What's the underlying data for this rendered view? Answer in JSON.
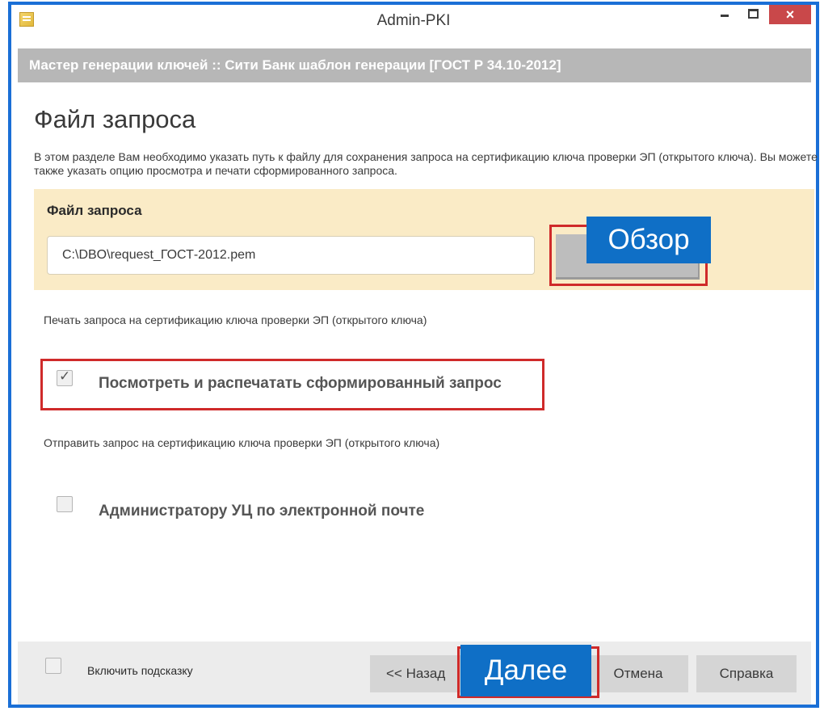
{
  "window": {
    "title": "Admin-PKI",
    "close_glyph": "×"
  },
  "wizard": {
    "header": "Мастер генерации ключей :: Сити Банк шаблон генерации [ГОСТ Р 34.10-2012]",
    "page_title": "Файл запроса",
    "description": "В этом разделе Вам необходимо указать путь к файлу для сохранения запроса на сертификацию ключа проверки ЭП (открытого ключа). Вы можете также указать опцию просмотра и печати сформированного запроса."
  },
  "file_section": {
    "label": "Файл запроса",
    "path_value": "C:\\DBO\\request_ГОСТ-2012.pem",
    "browse_callout": "Обзор"
  },
  "print_section": {
    "caption": "Печать запроса на сертификацию ключа проверки ЭП (открытого ключа)",
    "checkbox_label": "Посмотреть и распечатать сформированный запрос",
    "checked": true
  },
  "send_section": {
    "caption": "Отправить запрос на сертификацию ключа проверки ЭП (открытого ключа)",
    "checkbox_label": "Администратору УЦ по электронной почте",
    "checked": false
  },
  "footer": {
    "hint_label": "Включить подсказку",
    "back_label": "<< Назад",
    "next_callout": "Далее",
    "cancel_label": "Отмена",
    "help_label": "Справка"
  },
  "colors": {
    "window_border": "#1a6fd6",
    "callout_blue": "#0f6fc6",
    "highlight_red": "#cf2a2a",
    "file_panel_bg": "#faebc6",
    "header_gray": "#b7b7b7"
  }
}
